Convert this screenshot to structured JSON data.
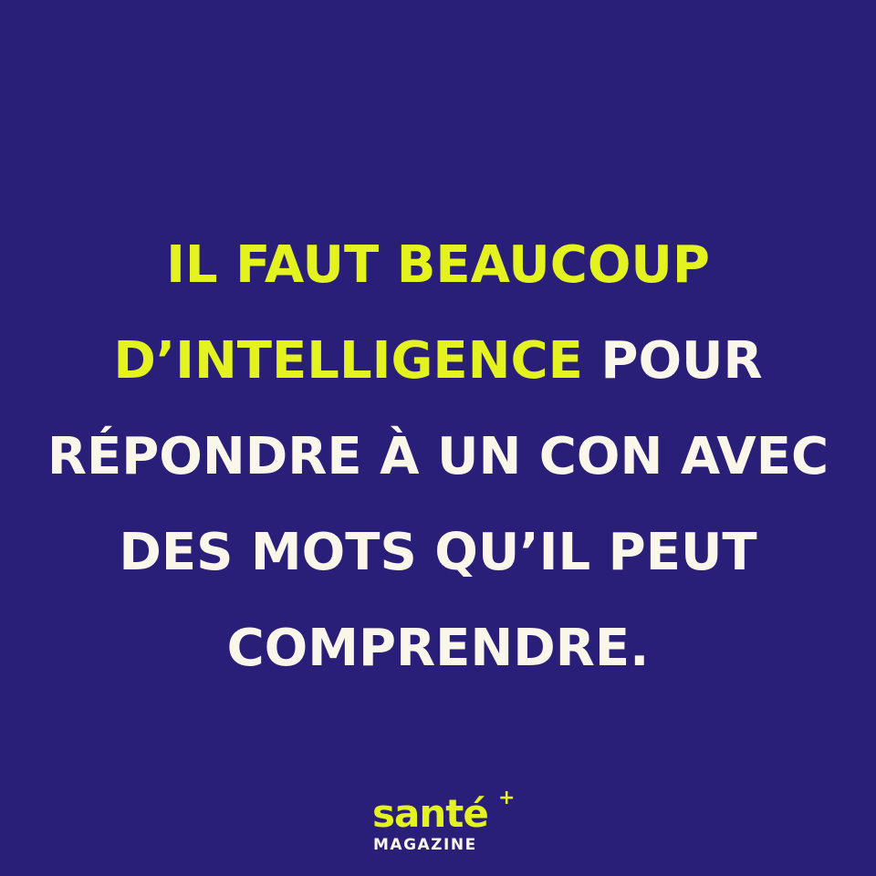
{
  "background_color": "#2a1f78",
  "highlight_color": "#e4f31f",
  "text_color": "#fbf6ea",
  "quote": {
    "line1": "IL FAUT BEAUCOUP",
    "line2_highlight": "D’INTELLIGENCE",
    "line2_rest": " POUR",
    "line3": "RÉPONDRE À UN CON AVEC",
    "line4": "DES MOTS QU’IL PEUT",
    "line5": "COMPRENDRE."
  },
  "logo": {
    "word": "santé",
    "plus": "+",
    "subtitle": "MAGAZINE"
  }
}
